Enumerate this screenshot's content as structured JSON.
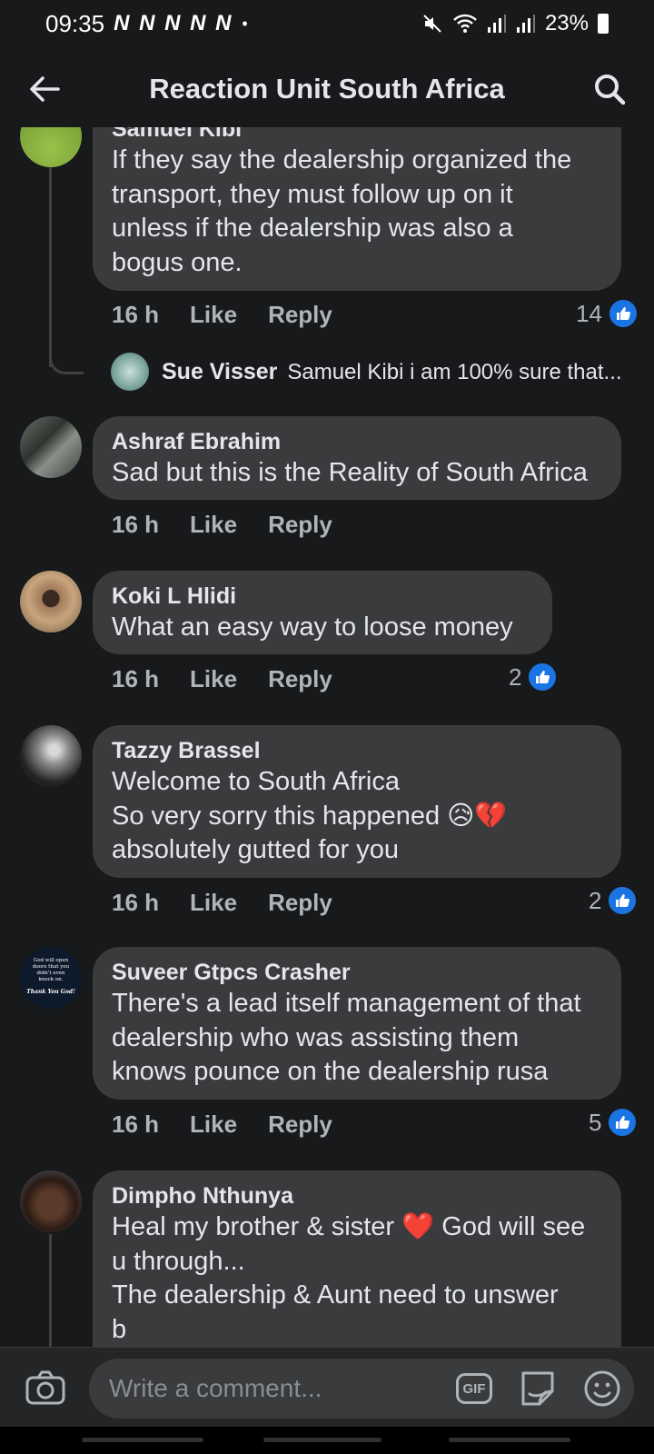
{
  "status_bar": {
    "time": "09:35",
    "notifications": "N N N N N",
    "dot": "•",
    "battery": "23%"
  },
  "header": {
    "title": "Reaction Unit South Africa",
    "back_icon": "arrow-left-icon",
    "search_icon": "search-icon"
  },
  "comments": [
    {
      "author": "Samuel Kibi",
      "text": "If they say the dealership organized the\ntransport, they must follow up on it\nunless if the dealership was also a\nbogus one.",
      "time": "16 h",
      "like": "Like",
      "reply": "Reply",
      "reactions": "14"
    },
    {
      "author": "Sue Visser",
      "text": "Samuel Kibi i am 100% sure that..."
    },
    {
      "author": "Ashraf Ebrahim",
      "text": "Sad but this is the Reality of South Africa",
      "time": "16 h",
      "like": "Like",
      "reply": "Reply"
    },
    {
      "author": "Koki L Hlidi",
      "text": "What an easy way to loose money",
      "time": "16 h",
      "like": "Like",
      "reply": "Reply",
      "reactions": "2"
    },
    {
      "author": "Tazzy Brassel",
      "text": "Welcome to South Africa\nSo very sorry this happened 😥💔\nabsolutely gutted for you",
      "time": "16 h",
      "like": "Like",
      "reply": "Reply",
      "reactions": "2"
    },
    {
      "author": "Suveer Gtpcs Crasher",
      "text": "There's a lead itself management of that\ndealership who was assisting them\nknows pounce on the dealership rusa",
      "time": "16 h",
      "like": "Like",
      "reply": "Reply",
      "reactions": "5",
      "avatar_text": "God will open doors that you didn't even knock on.",
      "avatar_caption": "Thank You God!"
    },
    {
      "author": "Dimpho Nthunya",
      "text": "Heal my brother & sister ❤️ God will see\nu through...\nThe dealership & Aunt need to unswer\nb"
    }
  ],
  "composer": {
    "placeholder": "Write a comment...",
    "gif_label": "GIF",
    "camera_icon": "camera-icon",
    "sticker_icon": "sticker-icon",
    "emoji_icon": "smiley-icon"
  },
  "colors": {
    "background": "#18191a",
    "bubble": "#3a3b3c",
    "like_blue": "#1b74e4",
    "meta_text": "#b0b3b8"
  }
}
